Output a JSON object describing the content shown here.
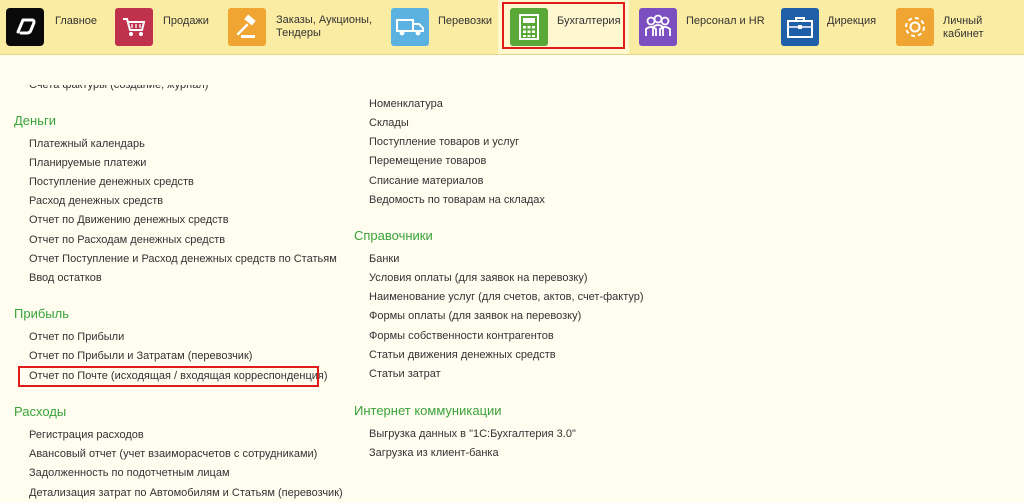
{
  "nav": {
    "tabs": [
      {
        "id": "main",
        "label": "Главное",
        "icon": "logo-icon",
        "color": "#0a0a0a"
      },
      {
        "id": "sales",
        "label": "Продажи",
        "icon": "cart-icon",
        "color": "#c0324b"
      },
      {
        "id": "orders",
        "label": "Заказы,  Аукционы, Тендеры",
        "icon": "gavel-icon",
        "color": "#f0a532"
      },
      {
        "id": "transport",
        "label": "Перевозки",
        "icon": "truck-icon",
        "color": "#5bb2e0"
      },
      {
        "id": "accounting",
        "label": "Бухгалтерия",
        "icon": "calculator-icon",
        "color": "#5aa837"
      },
      {
        "id": "hr",
        "label": "Персонал и HR",
        "icon": "people-icon",
        "color": "#7b4fbf"
      },
      {
        "id": "direction",
        "label": "Дирекция",
        "icon": "briefcase-icon",
        "color": "#1f5fa7"
      },
      {
        "id": "cabinet",
        "label": "Личный кабинет",
        "icon": "gear-icon",
        "color": "#f0a532"
      }
    ],
    "active": "Бухгалтерия"
  },
  "left": {
    "partial_top": "Счета фактуры (создание, журнал)",
    "money": {
      "title": "Деньги",
      "items": [
        "Платежный календарь",
        "Планируемые платежи",
        "Поступление денежных средств",
        "Расход денежных средств",
        "Отчет по Движению денежных средств",
        "Отчет по Расходам денежных средств",
        "Отчет Поступление и Расход денежных средств по Статьям",
        "Ввод остатков"
      ]
    },
    "profit": {
      "title": "Прибыль",
      "items": [
        "Отчет по Прибыли",
        "Отчет по Прибыли и Затратам (перевозчик)",
        "Отчет по Почте (исходящая / входящая корреспонденция)"
      ]
    },
    "expenses": {
      "title": "Расходы",
      "items": [
        "Регистрация расходов",
        "Авансовый отчет (учет взаиморасчетов с сотрудниками)",
        "Задолженность по подотчетным лицам",
        "Детализация затрат по Автомобилям и Статьям (перевозчик)"
      ]
    }
  },
  "right": {
    "goods": {
      "items": [
        "Номенклатура",
        "Склады",
        "Поступление товаров и услуг",
        "Перемещение товаров",
        "Списание материалов",
        "Ведомость по товарам на складах"
      ]
    },
    "refs": {
      "title": "Справочники",
      "items": [
        "Банки",
        "Условия оплаты (для заявок на перевозку)",
        "Наименование услуг (для счетов, актов, счет-фактур)",
        "Формы оплаты (для заявок на перевозку)",
        "Формы собственности контрагентов",
        "Статьи движения денежных средств",
        "Статьи затрат"
      ]
    },
    "internet": {
      "title": "Интернет коммуникации",
      "items": [
        "Выгрузка данных в \"1С:Бухгалтерия 3.0\"",
        "Загрузка из клиент-банка"
      ]
    }
  }
}
